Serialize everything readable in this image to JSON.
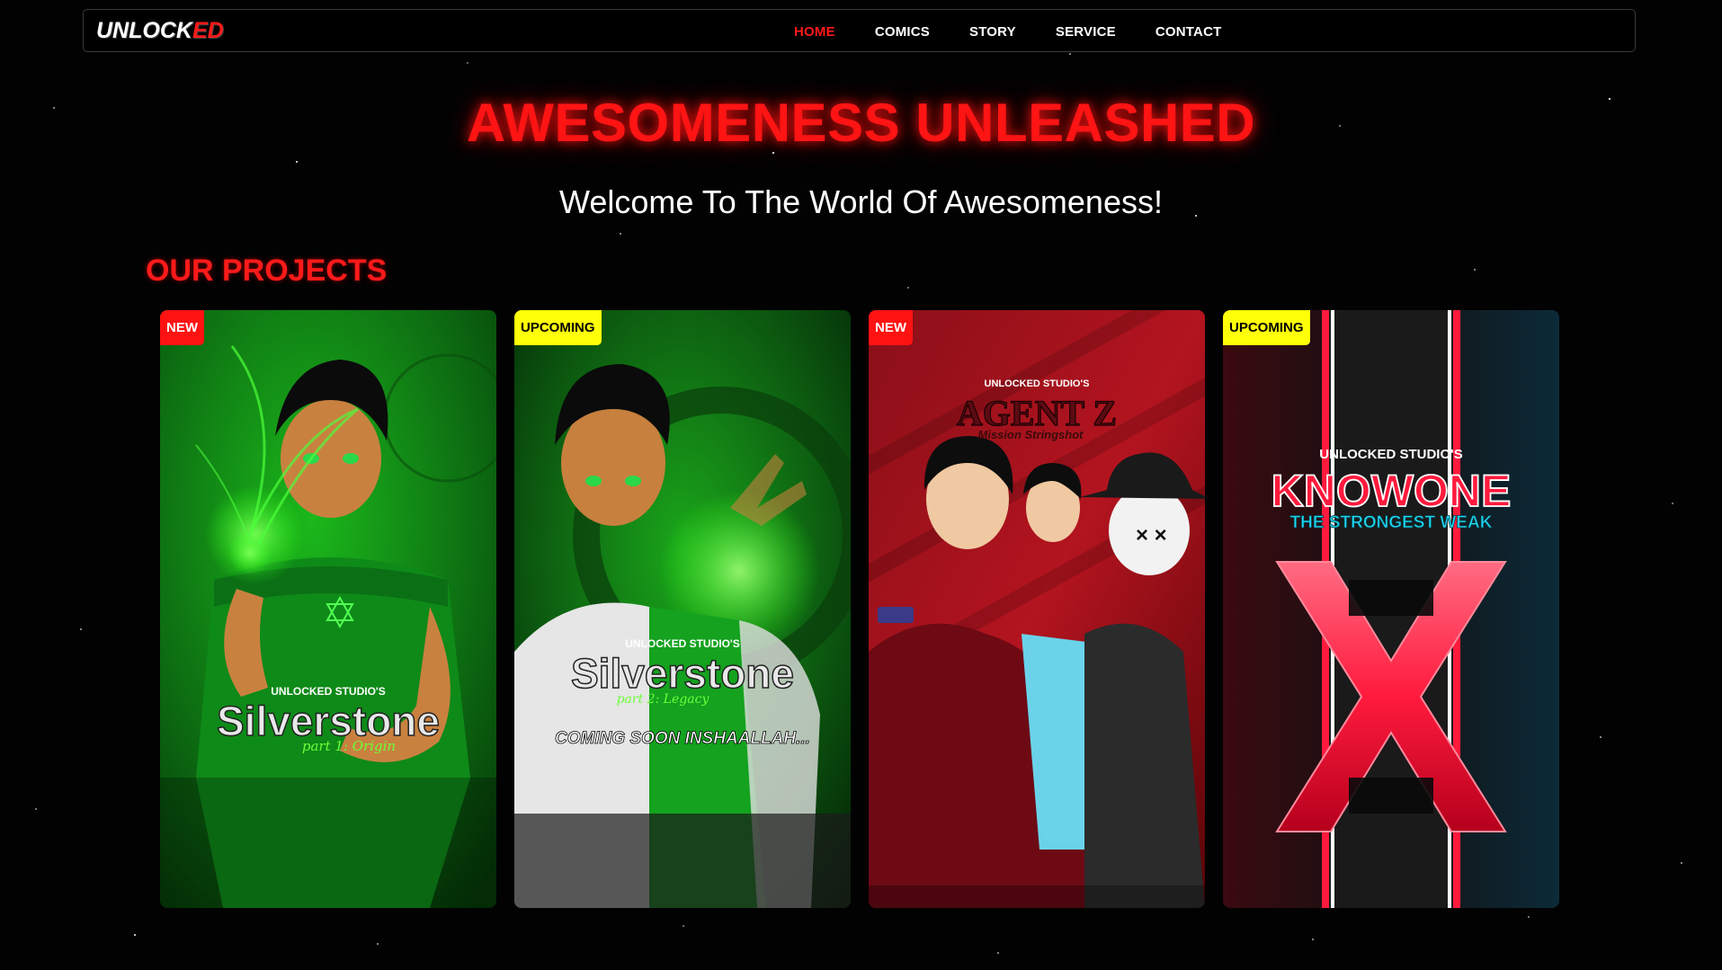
{
  "brand": {
    "logo_main": "UNLOCK",
    "logo_accent": "ED"
  },
  "nav": {
    "items": [
      {
        "label": "HOME",
        "active": true
      },
      {
        "label": "COMICS",
        "active": false
      },
      {
        "label": "STORY",
        "active": false
      },
      {
        "label": "SERVICE",
        "active": false
      },
      {
        "label": "CONTACT",
        "active": false
      }
    ]
  },
  "hero": {
    "title": "AWESOMENESS UNLEASHED",
    "subtitle": "Welcome To The World Of Awesomeness!"
  },
  "projects": {
    "heading": "OUR PROJECTS",
    "cards": [
      {
        "badge": "NEW",
        "studio": "UNLOCKED STUDIO'S",
        "title": "Silverstone",
        "subtitle": "part 1: Origin",
        "tagline": ""
      },
      {
        "badge": "UPCOMING",
        "studio": "UNLOCKED STUDIO'S",
        "title": "Silverstone",
        "subtitle": "part 2: Legacy",
        "tagline": "COMING SOON INSHAALLAH..."
      },
      {
        "badge": "NEW",
        "studio": "UNLOCKED STUDIO'S",
        "title": "AGENT Z",
        "subtitle": "Mission Stringshot",
        "tagline": ""
      },
      {
        "badge": "UPCOMING",
        "studio": "UNLOCKED STUDIO'S",
        "title": "KNOWONE",
        "subtitle": "THE STRONGEST WEAK",
        "tagline": ""
      }
    ]
  },
  "colors": {
    "accent_red": "#ff1414",
    "badge_yellow": "#ffff0a",
    "background": "#020203"
  }
}
